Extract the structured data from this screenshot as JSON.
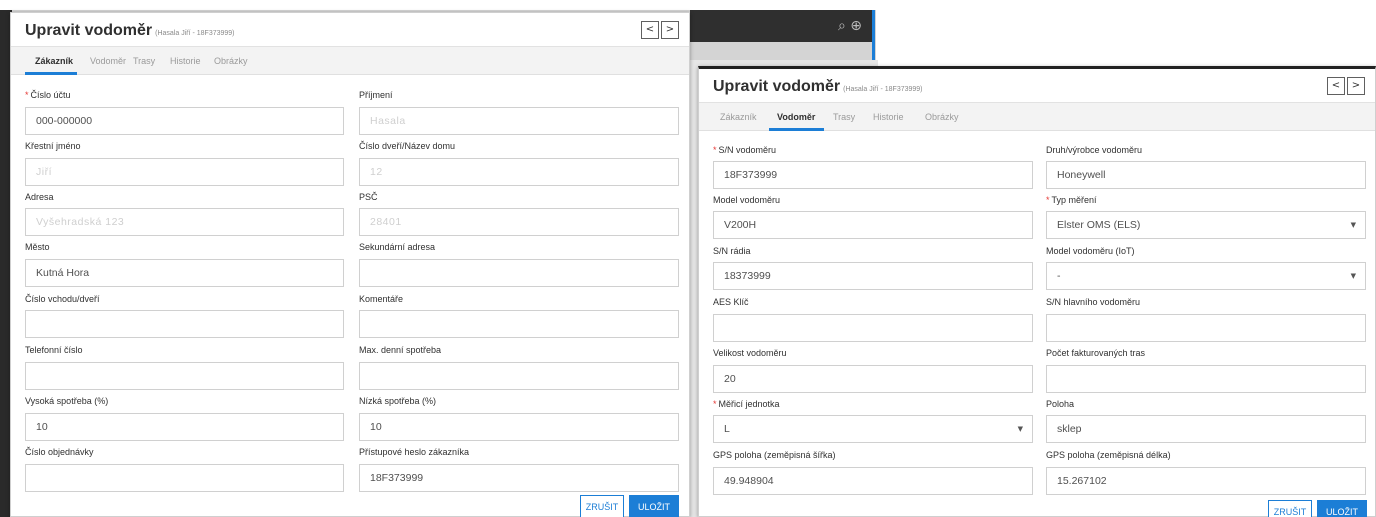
{
  "background": {
    "header_icons": "⌕ ⊕"
  },
  "dialog_customer": {
    "title": "Upravit vodoměr",
    "subtitle": "(Hasala Jiří - 18F373999)",
    "nav_prev": "<",
    "nav_next": ">",
    "tabs": [
      "Zákazník",
      "Vodoměr",
      "Trasy",
      "Historie",
      "Obrázky"
    ],
    "active_tab": "Zákazník",
    "fields": {
      "account_number": {
        "label": "Číslo účtu",
        "value": "000-000000",
        "required": true
      },
      "surname": {
        "label": "Příjmení",
        "value": "Hasala"
      },
      "first_name": {
        "label": "Křestní jméno",
        "value": "Jiří"
      },
      "door_number": {
        "label": "Číslo dveří/Název domu",
        "value": "12"
      },
      "address": {
        "label": "Adresa",
        "value": "Vyšehradská 123"
      },
      "postcode": {
        "label": "PSČ",
        "value": "28401"
      },
      "city": {
        "label": "Město",
        "value": "Kutná Hora"
      },
      "secondary_address": {
        "label": "Sekundární adresa",
        "value": ""
      },
      "entrance_number": {
        "label": "Číslo vchodu/dveří",
        "value": ""
      },
      "comments": {
        "label": "Komentáře",
        "value": ""
      },
      "phone": {
        "label": "Telefonní číslo",
        "value": ""
      },
      "max_daily": {
        "label": "Max. denní spotřeba",
        "value": ""
      },
      "high_usage": {
        "label": "Vysoká spotřeba (%)",
        "value": "10"
      },
      "low_usage": {
        "label": "Nízká spotřeba (%)",
        "value": "10"
      },
      "order_number": {
        "label": "Číslo objednávky",
        "value": ""
      },
      "access_password": {
        "label": "Přístupové heslo zákazníka",
        "value": "18F373999"
      }
    },
    "cancel_label": "ZRUŠIT",
    "save_label": "ULOŽIT"
  },
  "dialog_meter": {
    "title": "Upravit vodoměr",
    "subtitle": "(Hasala Jiří - 18F373999)",
    "nav_prev": "<",
    "nav_next": ">",
    "tabs": [
      "Zákazník",
      "Vodoměr",
      "Trasy",
      "Historie",
      "Obrázky"
    ],
    "active_tab": "Vodoměr",
    "fields": {
      "meter_sn": {
        "label": "S/N vodoměru",
        "value": "18F373999",
        "required": true
      },
      "manufacturer": {
        "label": "Druh/výrobce vodoměru",
        "value": "Honeywell"
      },
      "model": {
        "label": "Model vodoměru",
        "value": "V200H"
      },
      "measurement_type": {
        "label": "Typ měření",
        "value": "Elster OMS (ELS)",
        "required": true
      },
      "radio_sn": {
        "label": "S/N rádia",
        "value": "18373999"
      },
      "iot_model": {
        "label": "Model vodoměru (IoT)",
        "value": "-"
      },
      "aes_key": {
        "label": "AES Klíč",
        "value": ""
      },
      "main_meter_sn": {
        "label": "S/N hlavního vodoměru",
        "value": ""
      },
      "meter_size": {
        "label": "Velikost vodoměru",
        "value": "20"
      },
      "billed_routes": {
        "label": "Počet fakturovaných tras",
        "value": ""
      },
      "unit": {
        "label": "Měřicí jednotka",
        "value": "L",
        "required": true
      },
      "location": {
        "label": "Poloha",
        "value": "sklep"
      },
      "gps_lat": {
        "label": "GPS poloha (zeměpisná šířka)",
        "value": "49.948904"
      },
      "gps_lon": {
        "label": "GPS poloha (zeměpisná délka)",
        "value": "15.267102"
      }
    },
    "cancel_label": "ZRUŠIT",
    "save_label": "ULOŽIT"
  },
  "colors": {
    "accent": "#1c7ed6",
    "required": "#e53935",
    "background_dark": "#2f2f2f"
  },
  "icons": [
    "search-icon",
    "globe-icon",
    "chevron-left-icon",
    "chevron-right-icon",
    "chevron-down-icon"
  ]
}
